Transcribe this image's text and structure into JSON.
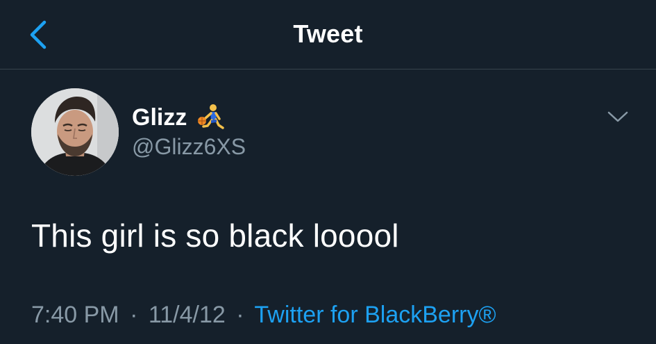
{
  "header": {
    "title": "Tweet",
    "back_icon": "chevron-left-icon",
    "accent": "#1da1f2"
  },
  "author": {
    "display_name": "Glizz",
    "badge_icon": "basketball-player-emoji-icon",
    "handle": "@Glizz6XS"
  },
  "tweet": {
    "text": "This girl is so black looool"
  },
  "meta": {
    "time": "7:40 PM",
    "separator": "·",
    "date": "11/4/12",
    "source": "Twitter for BlackBerry®"
  },
  "colors": {
    "background": "#15202b",
    "divider": "#38444d",
    "secondary_text": "#8899a6",
    "link": "#1da1f2"
  }
}
